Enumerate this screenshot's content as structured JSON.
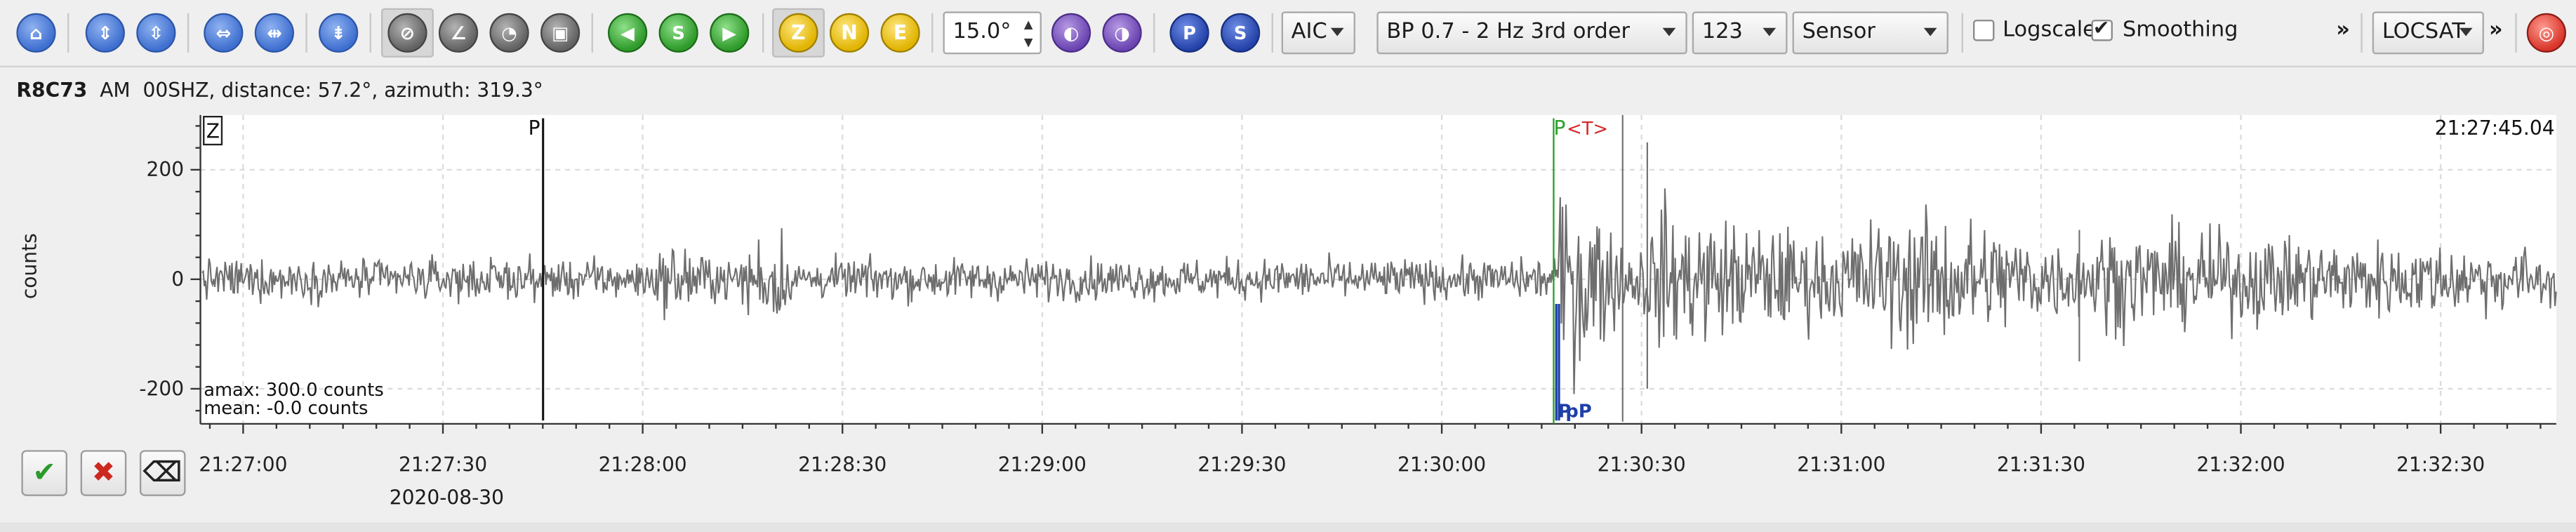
{
  "toolbar": {
    "zoom_value": "15.0°",
    "picker_method": "AIC",
    "filter": "BP 0.7 - 2 Hz  3rd order",
    "components": "123",
    "unit": "Sensor",
    "logscale_label": "Logscale",
    "logscale_checked": false,
    "smoothing_label": "Smoothing",
    "smoothing_checked": true,
    "more_label": "»",
    "locator": "LOCSAT",
    "component_z": "Z",
    "component_n": "N",
    "component_e": "E",
    "pick_p": "P",
    "pick_s": "S"
  },
  "trace": {
    "station": "R8C73",
    "network": "AM",
    "channel": "00SHZ",
    "distance_text": "distance: 57.2°",
    "azimuth_text": "azimuth: 319.3°",
    "component_label": "Z",
    "time_label": "21:27:45.04",
    "amax": "amax: 300.0 counts",
    "mean": "mean: -0.0 counts",
    "date": "2020-08-30"
  },
  "chart_data": {
    "type": "line",
    "title": "",
    "ylabel": "counts",
    "ylim": [
      -260,
      300
    ],
    "yticks": [
      200,
      0,
      -200
    ],
    "x_tick_labels": [
      "21:27:00",
      "21:27:30",
      "21:28:00",
      "21:28:30",
      "21:29:00",
      "21:29:30",
      "21:30:00",
      "21:30:30",
      "21:31:00",
      "21:31:30",
      "21:32:00",
      "21:32:30"
    ],
    "grid": true,
    "picks": [
      {
        "label": "P",
        "color": "#111111",
        "time": "21:27:45.04"
      },
      {
        "label": "P",
        "color": "#2ca02c",
        "time": "21:30:16.8"
      },
      {
        "label": "<T>",
        "color": "#d62728",
        "time": "21:30:16.8"
      }
    ],
    "bottom_picks": [
      {
        "label": "P",
        "color": "#1f3fa8",
        "time": "21:30:17.2"
      },
      {
        "label": "pP",
        "color": "#1f3fa8",
        "time": "21:30:17.6"
      }
    ],
    "noise_amplitude": 20,
    "max_amplitude": 300,
    "min_amplitude": -260
  }
}
